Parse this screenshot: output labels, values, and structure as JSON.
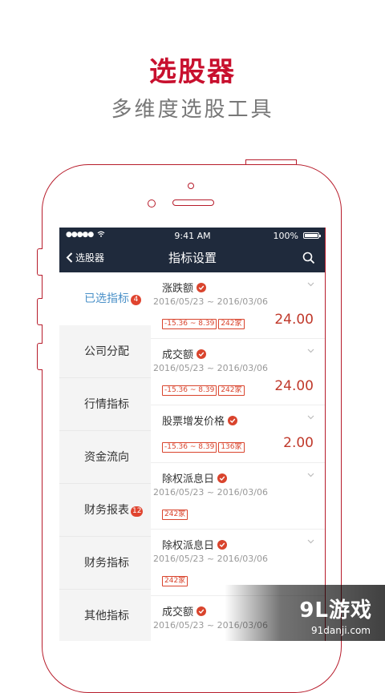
{
  "promo": {
    "title": "选股器",
    "subtitle": "多维度选股工具"
  },
  "status_bar": {
    "signal": "●●●●●",
    "time": "9:41 AM",
    "battery_text": "100%"
  },
  "nav": {
    "back_label": "选股器",
    "title": "指标设置"
  },
  "categories": [
    {
      "label": "已选指标",
      "badge": "4",
      "active": true
    },
    {
      "label": "公司分配",
      "badge": ""
    },
    {
      "label": "行情指标",
      "badge": ""
    },
    {
      "label": "资金流向",
      "badge": ""
    },
    {
      "label": "财务报表",
      "badge": "12"
    },
    {
      "label": "财务指标",
      "badge": ""
    },
    {
      "label": "其他指标",
      "badge": ""
    }
  ],
  "indicators": [
    {
      "name": "涨跌额",
      "date": "2016/05/23 ~ 2016/03/06",
      "range": "-15.36 ~ 8.39",
      "count": "242家",
      "value": "24.00"
    },
    {
      "name": "成交额",
      "date": "2016/05/23 ~ 2016/03/06",
      "range": "-15.36 ~ 8.39",
      "count": "242家",
      "value": "24.00"
    },
    {
      "name": "股票增发价格",
      "date": "",
      "range": "-15.36 ~ 8.39",
      "count": "136家",
      "value": "2.00"
    },
    {
      "name": "除权派息日",
      "date": "2016/05/23 ~ 2016/03/06",
      "range": "",
      "count": "242家",
      "value": ""
    },
    {
      "name": "除权派息日",
      "date": "2016/05/23 ~ 2016/03/06",
      "range": "",
      "count": "242家",
      "value": ""
    },
    {
      "name": "成交额",
      "date": "2016/05/23 ~ 2016/03/06",
      "range": "",
      "count": "",
      "value": ""
    }
  ],
  "watermark": {
    "logo": "9L游戏",
    "url": "91danji.com"
  },
  "colors": {
    "brand_red": "#c8102e",
    "nav_dark": "#1f2a3c",
    "active_blue": "#4a90c8",
    "badge_red": "#e0442f"
  },
  "icons": [
    "back-chevron-icon",
    "search-icon",
    "check-icon",
    "chevron-down-icon",
    "battery-icon",
    "wifi-icon"
  ]
}
